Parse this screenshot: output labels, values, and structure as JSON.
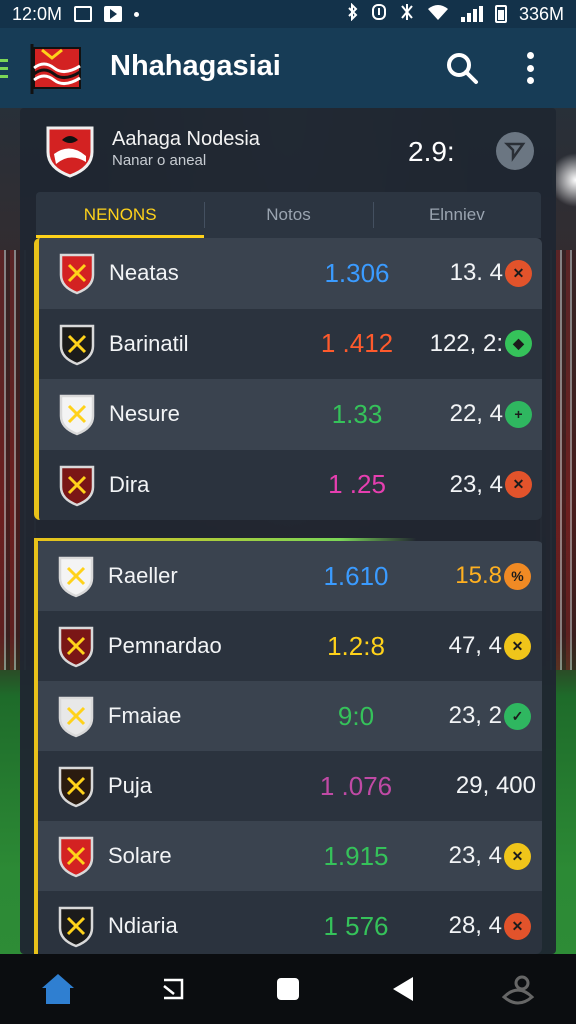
{
  "status_bar": {
    "time": "12:0M",
    "right_text": "336M"
  },
  "app_bar": {
    "title": "Nhahagasiai"
  },
  "team_header": {
    "name": "Aahaga Nodesia",
    "subtitle": "Nanar o aneal",
    "value": "2.9:"
  },
  "tabs": [
    {
      "label": "NENONS",
      "active": true
    },
    {
      "label": "Notos",
      "active": false
    },
    {
      "label": "Elnniev",
      "active": false
    }
  ],
  "group1": [
    {
      "label": "Neatas",
      "odds": "1.306",
      "odds_color": "#3a9bff",
      "amount": "13. 4",
      "dot_color": "#e2532b",
      "dot_icon": "x"
    },
    {
      "label": "Barinatil",
      "odds": "1 .412",
      "odds_color": "#ff5a2c",
      "amount": "122, 2:",
      "dot_color": "#35c25a",
      "dot_icon": "shield"
    },
    {
      "label": "Nesure",
      "odds": "1.33",
      "odds_color": "#35c25a",
      "amount": "22, 4",
      "dot_color": "#2fb760",
      "dot_icon": "+"
    },
    {
      "label": "Dira",
      "odds": "1 .25",
      "odds_color": "#e63fb0",
      "amount": "23, 4",
      "dot_color": "#e2532b",
      "dot_icon": "x"
    }
  ],
  "group2": [
    {
      "label": "Raeller",
      "odds": "1.610",
      "odds_color": "#3a9bff",
      "amount": "15.8",
      "amount_color": "#ffb020",
      "dot_color": "#f08a24",
      "dot_icon": "%"
    },
    {
      "label": "Pemnardao",
      "odds": "1.2:8",
      "odds_color": "#ffd21a",
      "amount": "47, 4",
      "dot_color": "#f0c51a",
      "dot_icon": "x"
    },
    {
      "label": "Fmaiae",
      "odds": "9:0",
      "odds_color": "#35c25a",
      "amount": "23, 2",
      "dot_color": "#2fb760",
      "dot_icon": "check"
    },
    {
      "label": "Puja",
      "odds": "1 .076",
      "odds_color": "#c04aa5",
      "amount": "29, 400",
      "dot_color": "",
      "dot_icon": ""
    },
    {
      "label": "Solare",
      "odds": "1.915",
      "odds_color": "#35c25a",
      "amount": "23, 4",
      "dot_color": "#f0c51a",
      "dot_icon": "x"
    },
    {
      "label": "Ndiaria",
      "odds": "1 576",
      "odds_color": "#35c25a",
      "amount": "28, 4",
      "dot_color": "#e2532b",
      "dot_icon": "x"
    }
  ],
  "colors": {
    "accent_yellow": "#ffd21a",
    "app_bar": "#173c56",
    "panel": "#1f2731"
  },
  "icons": {
    "status_bar": [
      "gallery-icon",
      "play-store-icon",
      "notification-dot-icon",
      "bluetooth-icon",
      "alarm-icon",
      "vibrate-icon",
      "wifi-icon",
      "signal-icon",
      "battery-icon"
    ],
    "app_bar": [
      "menu-icon",
      "flag-logo-icon",
      "search-icon",
      "more-vert-icon"
    ],
    "nav_bar": [
      "home-icon",
      "recent-apps-icon",
      "square-icon",
      "back-icon",
      "assistant-icon"
    ]
  }
}
